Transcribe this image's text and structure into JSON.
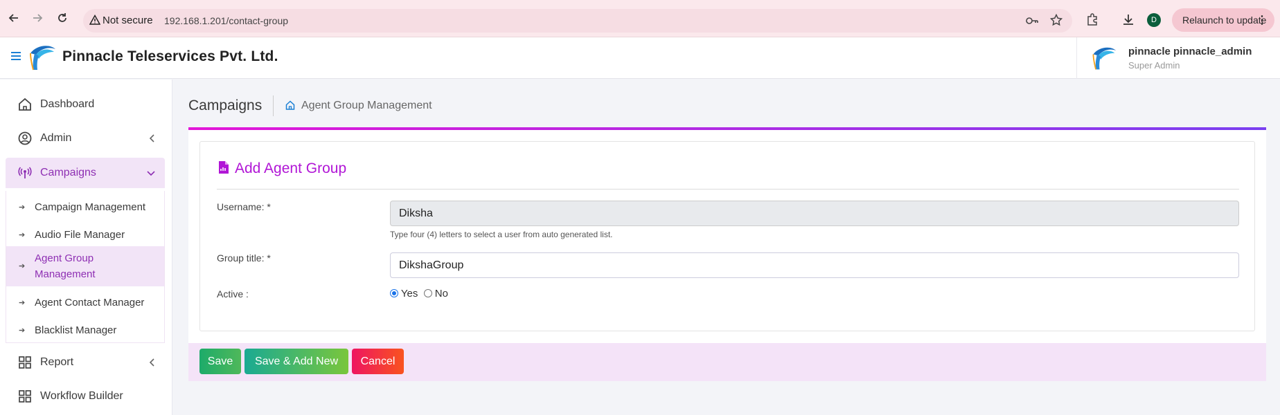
{
  "browser": {
    "security_label": "Not secure",
    "url": "192.168.1.201/contact-group",
    "profile_initial": "D",
    "relaunch_label": "Relaunch to update"
  },
  "header": {
    "company": "Pinnacle Teleservices Pvt. Ltd.",
    "user_name": "pinnacle pinnacle_admin",
    "user_role": "Super Admin"
  },
  "sidebar": {
    "items": [
      {
        "label": "Dashboard",
        "icon": "home-icon"
      },
      {
        "label": "Admin",
        "icon": "user-circle-icon"
      },
      {
        "label": "Campaigns",
        "icon": "broadcast-icon"
      },
      {
        "label": "Report",
        "icon": "grid-icon"
      },
      {
        "label": "Workflow Builder",
        "icon": "grid-icon"
      }
    ],
    "campaign_sub": [
      {
        "label": "Campaign Management"
      },
      {
        "label": "Audio File Manager"
      },
      {
        "label": "Agent Group Management"
      },
      {
        "label": "Agent Contact Manager"
      },
      {
        "label": "Blacklist Manager"
      }
    ]
  },
  "main": {
    "page_title": "Campaigns",
    "breadcrumb": "Agent Group Management",
    "form": {
      "title": "Add Agent Group",
      "username_label": "Username: *",
      "username_value": "Diksha",
      "username_help": "Type four (4) letters to select a user from auto generated list.",
      "group_title_label": "Group title: *",
      "group_title_value": "DikshaGroup",
      "active_label": "Active :",
      "active_yes": "Yes",
      "active_no": "No",
      "active_selected": "Yes"
    },
    "buttons": {
      "save": "Save",
      "save_add_new": "Save & Add New",
      "cancel": "Cancel"
    }
  },
  "colors": {
    "accent": "#b116d6",
    "sidebar_active_bg": "#f2e4f7",
    "save_button": "#1dab6a",
    "cancel_button": "#ee1561"
  }
}
